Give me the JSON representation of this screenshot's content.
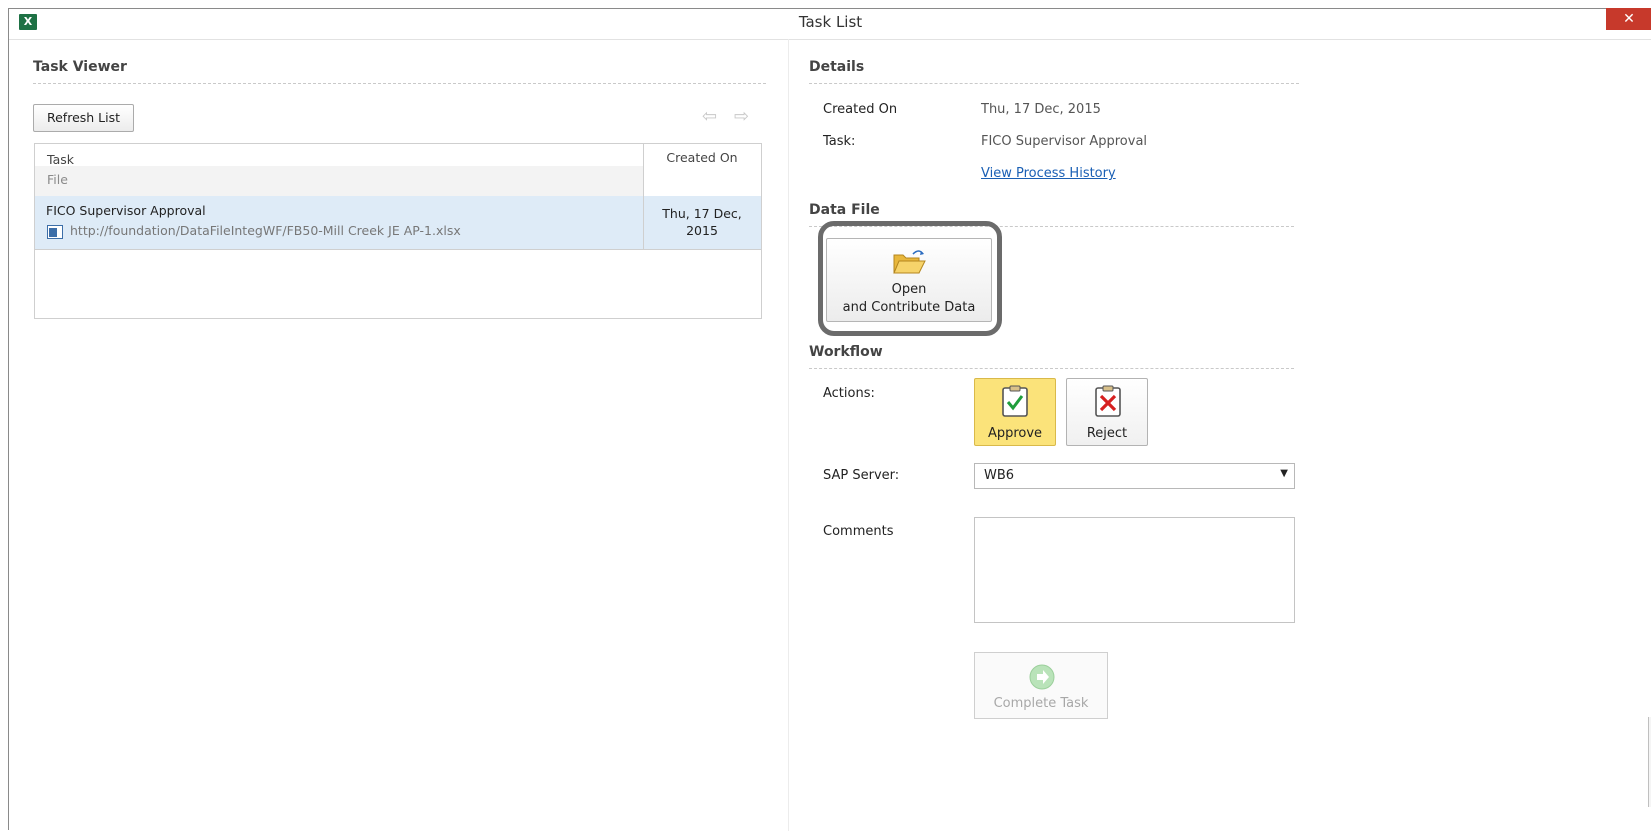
{
  "window": {
    "title": "Task List",
    "app_icon_label": "X",
    "close_label": "✕"
  },
  "task_viewer": {
    "title": "Task Viewer",
    "refresh_label": "Refresh List",
    "prev_arrow": "⇦",
    "next_arrow": "⇨",
    "columns": {
      "task": "Task",
      "file": "File",
      "created_on": "Created On"
    },
    "rows": [
      {
        "task": "FICO Supervisor Approval",
        "file": "http://foundation/DataFileIntegWF/FB50-Mill Creek JE AP-1.xlsx",
        "created_on_line1": "Thu, 17 Dec,",
        "created_on_line2": "2015",
        "file_icon": "excel-file-icon"
      }
    ]
  },
  "details": {
    "title": "Details",
    "created_on_label": "Created On",
    "created_on_value": "Thu, 17 Dec, 2015",
    "task_label": "Task:",
    "task_value": "FICO Supervisor Approval",
    "history_link": "View Process History"
  },
  "data_file": {
    "title": "Data File",
    "open_line1": "Open",
    "open_line2": "and Contribute Data",
    "icon": "open-folder-icon"
  },
  "workflow": {
    "title": "Workflow",
    "actions_label": "Actions:",
    "approve_label": "Approve",
    "reject_label": "Reject",
    "sap_server_label": "SAP Server:",
    "sap_server_value": "WB6",
    "comments_label": "Comments",
    "comments_value": "",
    "complete_label": "Complete Task"
  },
  "colors": {
    "accent": "#1e7145",
    "selected_row": "#deebf7",
    "approve_active": "#fbe37a",
    "close": "#c7392b",
    "link": "#1a5fb4"
  }
}
